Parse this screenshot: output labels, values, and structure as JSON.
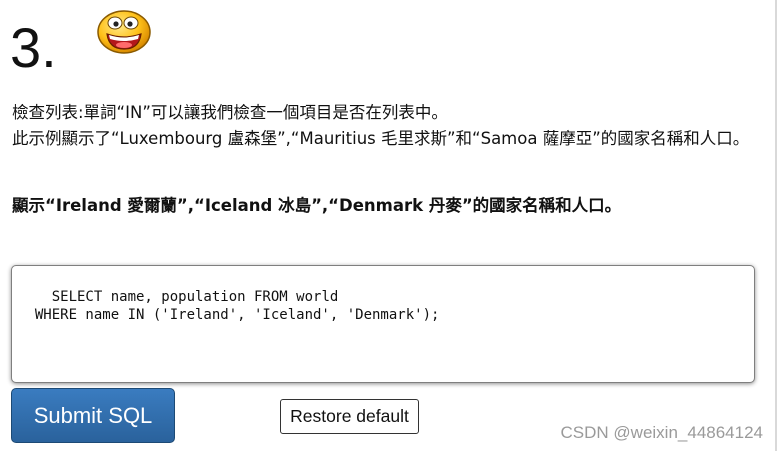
{
  "question": {
    "number": "3.",
    "emoji_icon": "smiley-face-icon"
  },
  "description": {
    "line1": "檢查列表:單詞“IN”可以讓我們檢查一個項目是否在列表中。",
    "line2": "此示例顯示了“Luxembourg 盧森堡”,“Mauritius 毛里求斯”和“Samoa 薩摩亞”的國家名稱和人口。"
  },
  "task": {
    "text": "顯示“Ireland 愛爾蘭”,“Iceland 冰島”,“Denmark 丹麥”的國家名稱和人口。"
  },
  "editor": {
    "sql": "SELECT name, population FROM world\n  WHERE name IN ('Ireland', 'Iceland', 'Denmark');"
  },
  "buttons": {
    "submit_label": "Submit SQL",
    "restore_label": "Restore default"
  },
  "watermark": {
    "text": "CSDN @weixin_44864124"
  },
  "colors": {
    "submit_bg": "#2f6ca9",
    "submit_text": "#ffffff",
    "watermark": "#9a9a9a"
  }
}
